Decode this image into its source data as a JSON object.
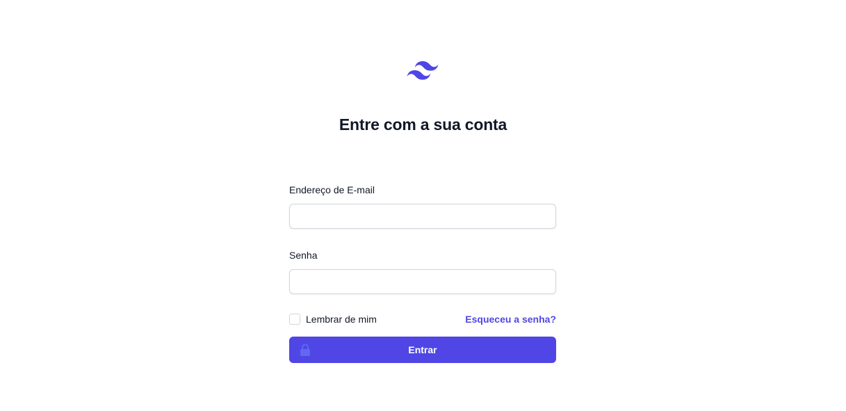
{
  "header": {
    "logo_icon": "tailwind-wave-logo",
    "title": "Entre com a sua conta"
  },
  "form": {
    "email_label": "Endereço de E-mail",
    "email_value": "",
    "password_label": "Senha",
    "password_value": "",
    "remember_label": "Lembrar de mim",
    "remember_checked": false,
    "forgot_link": "Esqueceu a senha?",
    "submit_label": "Entrar",
    "submit_icon": "lock-icon"
  },
  "colors": {
    "accent": "#4f46e5",
    "lock_icon": "#6366f1",
    "text": "#111827",
    "border": "#d1d5db"
  }
}
